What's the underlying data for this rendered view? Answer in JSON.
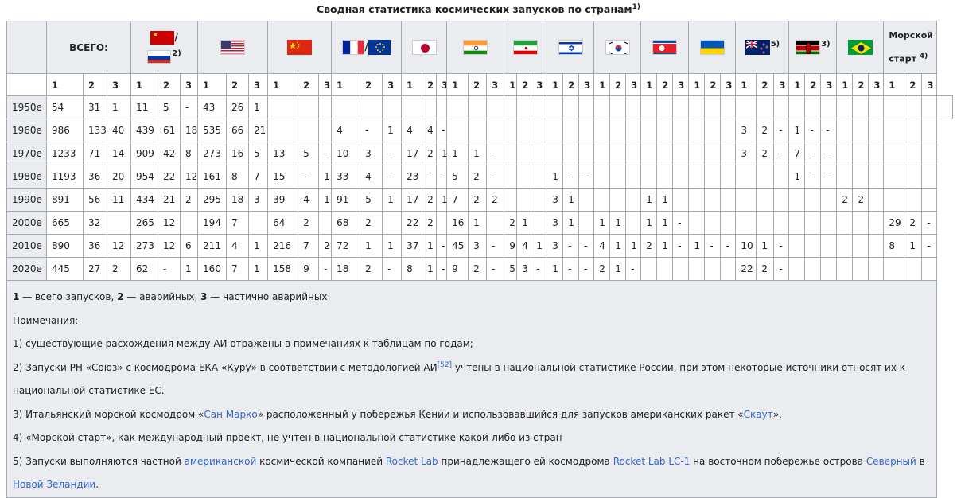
{
  "caption": {
    "text": "Сводная статистика космических запусков по странам",
    "sup": "1)"
  },
  "header": {
    "total_label": "ВСЕГО:",
    "sea_label_1": "Морской",
    "sea_label_2": "старт",
    "sea_sup": "4)",
    "su_ru_slash": "/",
    "su_ru_sup": "2)",
    "fr_eu_slash": "/",
    "nz_sup": "5)",
    "ke_sup": "3)",
    "sub": [
      "1",
      "2",
      "3"
    ]
  },
  "rows": [
    {
      "decade": "1950е",
      "cells": [
        "54",
        "31",
        "1",
        "11",
        "5",
        "-",
        "43",
        "26",
        "1",
        "",
        "",
        "",
        "",
        "",
        "",
        "",
        "",
        "",
        "",
        "",
        "",
        "",
        "",
        "",
        "",
        "",
        "",
        "",
        "",
        "",
        "",
        "",
        "",
        "",
        "",
        "",
        "",
        "",
        "",
        "",
        "",
        "",
        "",
        "",
        "",
        "",
        "",
        "",
        ""
      ]
    },
    {
      "decade": "1960е",
      "cells": [
        "986",
        "133",
        "40",
        "439",
        "61",
        "18",
        "535",
        "66",
        "21",
        "",
        "",
        "",
        "4",
        "-",
        "1",
        "4",
        "4",
        "-",
        "",
        "",
        "",
        "",
        "",
        "",
        "",
        "",
        "",
        "",
        "",
        "",
        "",
        "",
        "",
        "",
        "",
        "",
        "3",
        "2",
        "-",
        "1",
        "-",
        "-",
        "",
        "",
        "",
        "",
        "",
        ""
      ]
    },
    {
      "decade": "1970е",
      "cells": [
        "1233",
        "71",
        "14",
        "909",
        "42",
        "8",
        "273",
        "16",
        "5",
        "13",
        "5",
        "-",
        "10",
        "3",
        "-",
        "17",
        "2",
        "1",
        "1",
        "1",
        "-",
        "",
        "",
        "",
        "",
        "",
        "",
        "",
        "",
        "",
        "",
        "",
        "",
        "",
        "",
        "",
        "3",
        "2",
        "-",
        "7",
        "-",
        "-",
        "",
        "",
        "",
        "",
        "",
        ""
      ]
    },
    {
      "decade": "1980е",
      "cells": [
        "1193",
        "36",
        "20",
        "954",
        "22",
        "12",
        "161",
        "8",
        "7",
        "15",
        "-",
        "1",
        "33",
        "4",
        "-",
        "23",
        "-",
        "-",
        "5",
        "2",
        "-",
        "",
        "",
        "",
        "1",
        "-",
        "-",
        "",
        "",
        "",
        "",
        "",
        "",
        "",
        "",
        "",
        "",
        "",
        "",
        "1",
        "-",
        "-",
        "",
        "",
        "",
        "",
        "",
        ""
      ]
    },
    {
      "decade": "1990е",
      "cells": [
        "891",
        "56",
        "11",
        "434",
        "21",
        "2",
        "295",
        "18",
        "3",
        "39",
        "4",
        "1",
        "91",
        "5",
        "1",
        "17",
        "2",
        "1",
        "7",
        "2",
        "2",
        "",
        "",
        "",
        "3",
        "1",
        "",
        "",
        "",
        "",
        "1",
        "1",
        "",
        "",
        "",
        "",
        "",
        "",
        "",
        "",
        "",
        "",
        "2",
        "2",
        "",
        "",
        "",
        ""
      ]
    },
    {
      "decade": "2000е",
      "cells": [
        "665",
        "32",
        "",
        "265",
        "12",
        "",
        "194",
        "7",
        "",
        "64",
        "2",
        "",
        "68",
        "2",
        "",
        "22",
        "2",
        "",
        "16",
        "1",
        "",
        "2",
        "1",
        "",
        "3",
        "1",
        "",
        "1",
        "1",
        "",
        "1",
        "1",
        "-",
        "",
        "",
        "",
        "",
        "",
        "",
        "",
        "",
        "",
        "",
        "",
        "",
        "29",
        "2",
        "-"
      ]
    },
    {
      "decade": "2010е",
      "cells": [
        "890",
        "36",
        "12",
        "273",
        "12",
        "6",
        "211",
        "4",
        "1",
        "216",
        "7",
        "2",
        "72",
        "1",
        "1",
        "37",
        "1",
        "-",
        "45",
        "3",
        "-",
        "9",
        "4",
        "1",
        "3",
        "-",
        "-",
        "4",
        "1",
        "1",
        "2",
        "1",
        "-",
        "1",
        "-",
        "-",
        "10",
        "1",
        "-",
        "",
        "",
        "",
        "",
        "",
        "",
        "8",
        "1",
        "-"
      ]
    },
    {
      "decade": "2020е",
      "cells": [
        "445",
        "27",
        "2",
        "62",
        "-",
        "1",
        "160",
        "7",
        "1",
        "158",
        "9",
        "-",
        "18",
        "2",
        "-",
        "8",
        "1",
        "-",
        "9",
        "2",
        "-",
        "5",
        "3",
        "-",
        "1",
        "-",
        "-",
        "2",
        "1",
        "-",
        "",
        "",
        "",
        "",
        "",
        "",
        "22",
        "2",
        "-",
        "",
        "",
        "",
        "",
        "",
        "",
        "",
        "",
        ""
      ]
    }
  ],
  "legend": {
    "b1": "1",
    "t1": " — всего запусков, ",
    "b2": "2",
    "t2": " — аварийных, ",
    "b3": "3",
    "t3": " — частично аварийных"
  },
  "notes_title": "Примечания:",
  "notes": {
    "n1": "1) существующие расхождения между АИ отражены в примечаниях к таблицам по годам;",
    "n2a": "2) Запуски РН «Союз» с космодрома ЕКА «Куру» в соответствии с методологией АИ",
    "n2ref": "[52]",
    "n2b": " учтены в национальной статистике России, при этом некоторые источники относят их к национальной статистике ЕС.",
    "n3a": "3) Итальянский морской космодром «",
    "n3link1": "Сан Марко",
    "n3b": "» расположенный у побережья Кении и использовавшийся для запусков американских ракет «",
    "n3link2": "Скаут",
    "n3c": "».",
    "n4": "4) «Морской старт», как международный проект, не учтен в национальной статистике какой-либо из стран",
    "n5a": "5) Запуски выполняются частной ",
    "n5link1": "американской",
    "n5b": " космической компанией ",
    "n5link2": "Rocket Lab",
    "n5c": " принадлежащего ей космодрома ",
    "n5link3": "Rocket Lab LC-1",
    "n5d": " на восточном побережье острова ",
    "n5link4": "Северный",
    "n5e": " в ",
    "n5link5": "Новой Зеландии",
    "n5f": "."
  },
  "colors": {
    "header_bg": "#eaecf0",
    "border": "#a2a9b1",
    "link": "#3366cc"
  }
}
